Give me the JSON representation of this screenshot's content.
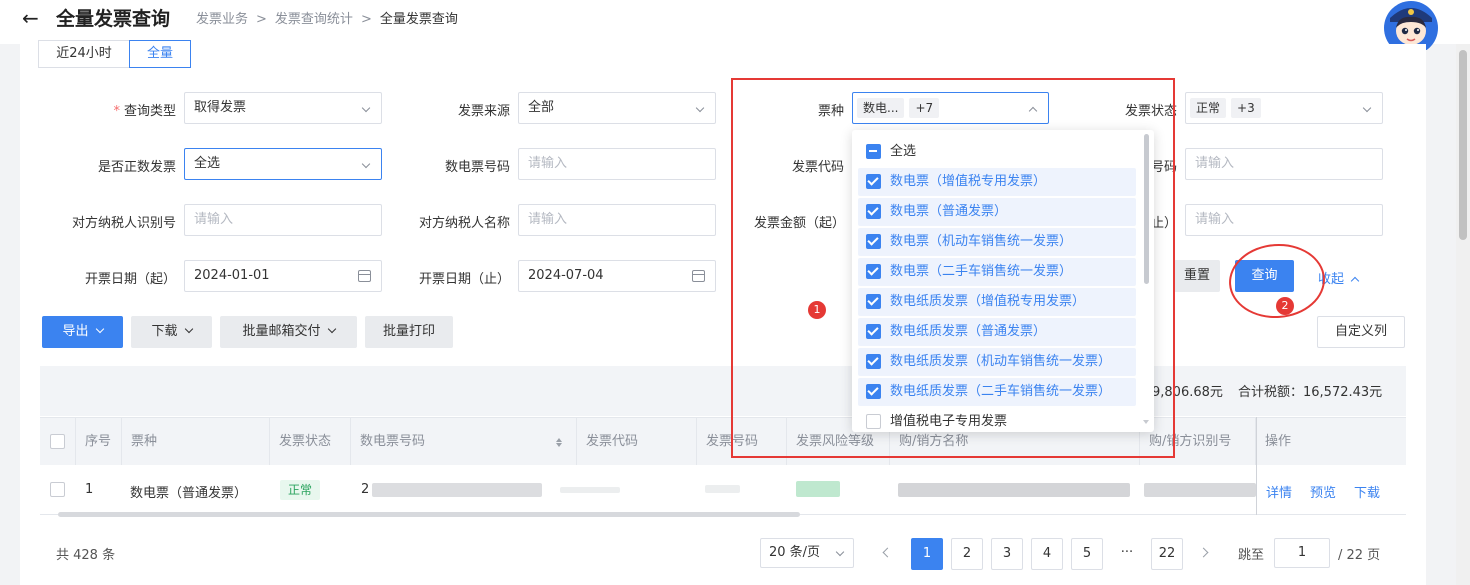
{
  "header": {
    "back": "←",
    "title": "全量发票查询",
    "breadcrumb": [
      "发票业务",
      "发票查询统计",
      "全量发票查询"
    ],
    "separator": ">"
  },
  "tabs": [
    "近24小时",
    "全量"
  ],
  "form": {
    "query_type": {
      "label": "查询类型",
      "value": "取得发票"
    },
    "invoice_source": {
      "label": "发票来源",
      "value": "全部"
    },
    "ticket_type": {
      "label": "票种",
      "tag": "数电...",
      "more": "+7"
    },
    "invoice_status": {
      "label": "发票状态",
      "tag": "正常",
      "more": "+3"
    },
    "is_positive": {
      "label": "是否正数发票",
      "value": "全选"
    },
    "digital_no": {
      "label": "数电票号码",
      "placeholder": "请输入"
    },
    "invoice_code": {
      "label": "发票代码"
    },
    "invoice_no": {
      "label_visible": "号码",
      "placeholder": "请输入"
    },
    "counter_tax_id": {
      "label": "对方纳税人识别号",
      "placeholder": "请输入"
    },
    "counter_name": {
      "label": "对方纳税人名称",
      "placeholder": "请输入"
    },
    "amount_start": {
      "label": "发票金额（起）"
    },
    "amount_end": {
      "label_visible": "止）",
      "placeholder": "请输入"
    },
    "date_start": {
      "label": "开票日期（起）",
      "value": "2024-01-01"
    },
    "date_end": {
      "label": "开票日期（止）",
      "value": "2024-07-04"
    },
    "reset": "重置",
    "query": "查询",
    "collapse": "收起"
  },
  "ticket_dropdown": {
    "items": [
      {
        "label": "全选",
        "state": "indeterminate"
      },
      {
        "label": "数电票（增值税专用发票）",
        "state": "checked"
      },
      {
        "label": "数电票（普通发票）",
        "state": "checked"
      },
      {
        "label": "数电票（机动车销售统一发票）",
        "state": "checked"
      },
      {
        "label": "数电票（二手车销售统一发票）",
        "state": "checked"
      },
      {
        "label": "数电纸质发票（增值税专用发票）",
        "state": "checked"
      },
      {
        "label": "数电纸质发票（普通发票）",
        "state": "checked"
      },
      {
        "label": "数电纸质发票（机动车销售统一发票）",
        "state": "checked"
      },
      {
        "label": "数电纸质发票（二手车销售统一发票）",
        "state": "checked"
      },
      {
        "label": "增值税电子专用发票",
        "state": "unchecked"
      }
    ]
  },
  "toolbar": {
    "export": "导出",
    "download": "下载",
    "batch_email": "批量邮箱交付",
    "batch_print": "批量打印",
    "custom_columns": "自定义列"
  },
  "summary": {
    "amount_partial": "9,806.68元",
    "tax_total": "合计税额：16,572.43元"
  },
  "table": {
    "columns": [
      "序号",
      "票种",
      "发票状态",
      "数电票号码",
      "发票代码",
      "发票号码",
      "发票风险等级",
      "购/销方名称",
      "购/销方识别号",
      "操作"
    ],
    "rows": [
      {
        "index": "1",
        "type": "数电票（普通发票）",
        "status": "正常",
        "digital_prefix": "2",
        "actions": [
          "详情",
          "预览",
          "下载"
        ]
      }
    ]
  },
  "pagination": {
    "total": "共 428 条",
    "page_size": "20 条/页",
    "pages": [
      "1",
      "2",
      "3",
      "4",
      "5",
      "···",
      "22"
    ],
    "current": "1",
    "jump_label": "跳至",
    "jump_value": "1",
    "jump_suffix": "/ 22 页"
  },
  "annotations": [
    "1",
    "2"
  ],
  "colors": {
    "primary": "#3b83f0",
    "annotation": "#e53935",
    "status_ok": "#2aa35d"
  }
}
